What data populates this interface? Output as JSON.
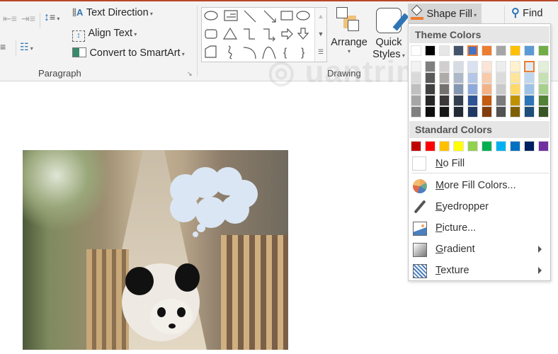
{
  "ribbon": {
    "paragraph": {
      "text_direction": "Text Direction",
      "align_text": "Align Text",
      "convert_smartart": "Convert to SmartArt",
      "group_label": "Paragraph"
    },
    "drawing": {
      "arrange": "Arrange",
      "quick_styles_line1": "Quick",
      "quick_styles_line2": "Styles",
      "group_label": "Drawing"
    },
    "shape_fill": "Shape Fill",
    "find": "Find"
  },
  "watermark": "Quantrimang",
  "menu": {
    "theme_colors_label": "Theme Colors",
    "theme_colors": [
      "#ffffff",
      "#000000",
      "#e7e6e6",
      "#44546a",
      "#4472c4",
      "#ed7d31",
      "#a5a5a5",
      "#ffc000",
      "#5b9bd5",
      "#70ad47"
    ],
    "theme_shades": [
      [
        "#f2f2f2",
        "#d9d9d9",
        "#bfbfbf",
        "#a6a6a6",
        "#808080"
      ],
      [
        "#7f7f7f",
        "#595959",
        "#404040",
        "#262626",
        "#0d0d0d"
      ],
      [
        "#d0cece",
        "#aeabab",
        "#757171",
        "#3a3838",
        "#171616"
      ],
      [
        "#d6dce4",
        "#adb9ca",
        "#8497b0",
        "#333f4f",
        "#222a35"
      ],
      [
        "#d9e2f3",
        "#b4c6e7",
        "#8eaadb",
        "#2f5496",
        "#1f3864"
      ],
      [
        "#fbe5d5",
        "#f7cbac",
        "#f4b183",
        "#c55a11",
        "#833c0b"
      ],
      [
        "#ededed",
        "#dbdbdb",
        "#c9c9c9",
        "#7b7b7b",
        "#525252"
      ],
      [
        "#fff2cc",
        "#fee599",
        "#ffd965",
        "#bf9000",
        "#7f6000"
      ],
      [
        "#deebf6",
        "#bdd7ee",
        "#9dc3e6",
        "#2e75b5",
        "#1e4e79"
      ],
      [
        "#e2efd9",
        "#c5e0b3",
        "#a8d08d",
        "#538135",
        "#375623"
      ]
    ],
    "selected_theme_color": "#4472c4",
    "hovered_shade": "#deebf6",
    "standard_colors_label": "Standard Colors",
    "standard_colors": [
      "#c00000",
      "#ff0000",
      "#ffc000",
      "#ffff00",
      "#92d050",
      "#00b050",
      "#00b0f0",
      "#0070c0",
      "#002060",
      "#7030a0"
    ],
    "no_fill": {
      "mnemonic": "N",
      "rest": "o Fill"
    },
    "more_fill_colors": {
      "mnemonic": "M",
      "rest": "ore Fill Colors..."
    },
    "eyedropper": {
      "mnemonic": "E",
      "rest": "yedropper"
    },
    "picture": {
      "mnemonic": "P",
      "rest": "icture..."
    },
    "gradient": {
      "mnemonic": "G",
      "rest": "radient"
    },
    "texture": {
      "mnemonic": "T",
      "rest": "exture"
    }
  },
  "colors": {
    "accent": "#b7472a",
    "callout_fill": "#dae6f3"
  }
}
